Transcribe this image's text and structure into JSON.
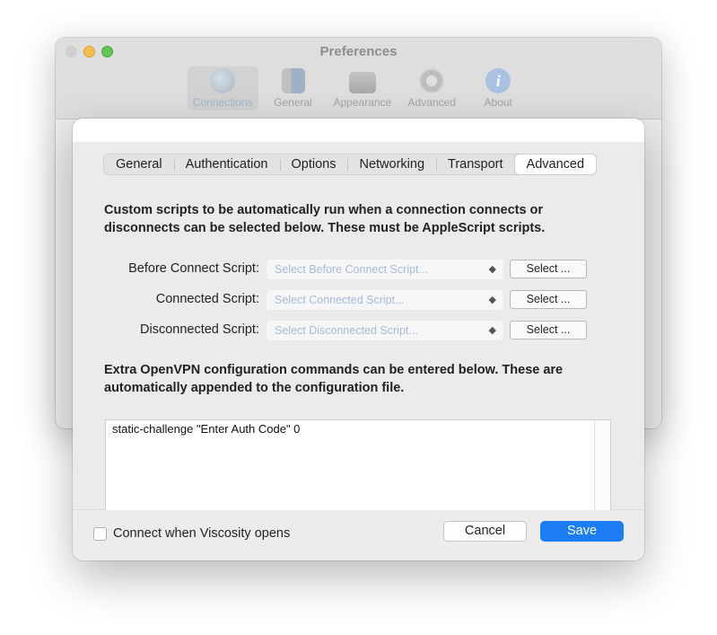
{
  "window": {
    "title": "Preferences"
  },
  "toolbar": {
    "items": [
      {
        "label": "Connections",
        "icon": "globe-icon",
        "active": true
      },
      {
        "label": "General",
        "icon": "switch-icon"
      },
      {
        "label": "Appearance",
        "icon": "monitor-icon"
      },
      {
        "label": "Advanced",
        "icon": "gear-icon"
      },
      {
        "label": "About",
        "icon": "info-icon"
      }
    ]
  },
  "sheet": {
    "tabs": [
      "General",
      "Authentication",
      "Options",
      "Networking",
      "Transport",
      "Advanced"
    ],
    "selected_tab": "Advanced",
    "scripts_intro": "Custom scripts to be automatically run when a connection connects or disconnects can be selected below. These must be AppleScript scripts.",
    "scripts": [
      {
        "label": "Before Connect Script:",
        "placeholder": "Select Before Connect Script...",
        "button": "Select ..."
      },
      {
        "label": "Connected Script:",
        "placeholder": "Select Connected Script...",
        "button": "Select ..."
      },
      {
        "label": "Disconnected Script:",
        "placeholder": "Select Disconnected Script...",
        "button": "Select ..."
      }
    ],
    "config_intro": "Extra OpenVPN configuration commands can be entered below. These are automatically appended to the configuration file.",
    "config_text": "static-challenge \"Enter Auth Code\" 0",
    "footer": {
      "checkbox_label": "Connect when Viscosity opens",
      "checkbox_checked": false,
      "cancel_label": "Cancel",
      "save_label": "Save"
    }
  },
  "colors": {
    "accent": "#1b7cf3",
    "placeholder": "#a7bbd7"
  }
}
